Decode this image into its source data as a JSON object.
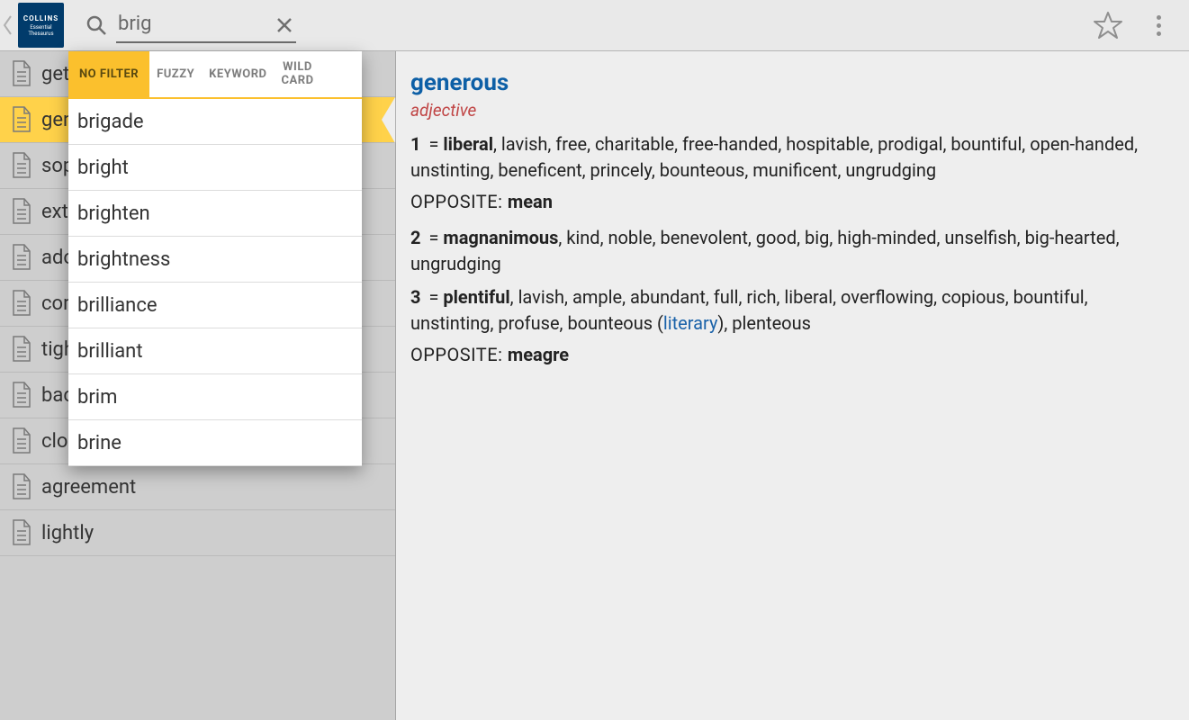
{
  "logo": {
    "line1": "COLLINS",
    "line2": "Essential",
    "line3": "Thesaurus"
  },
  "search": {
    "query": "brig"
  },
  "filters": {
    "nofilter": "NO FILTER",
    "fuzzy": "FUZZY",
    "keyword": "KEYWORD",
    "wild1": "WILD",
    "wild2": "CARD"
  },
  "suggestions": {
    "i0": "brigade",
    "i1": "bright",
    "i2": "brighten",
    "i3": "brightness",
    "i4": "brilliance",
    "i5": "brilliant",
    "i6": "brim",
    "i7": "brine"
  },
  "history": {
    "i0": "get",
    "i1": "generous",
    "i2": "sophisticated",
    "i3": "extreme",
    "i4": "adorn",
    "i5": "compromise",
    "i6": "tight",
    "i7": "background",
    "i8": "close",
    "i9": "agreement",
    "i10": "lightly"
  },
  "entry": {
    "word": "generous",
    "pos": "adjective",
    "s1": {
      "num": "1",
      "eq": " = ",
      "head": "liberal",
      "rest": ", lavish, free, charitable, free-handed, hospitable, prodigal, bountiful, open-handed, unstinting, beneficent, princely, bounteous, munificent, ungrudging"
    },
    "op1": {
      "label": "OPPOSITE: ",
      "word": "mean"
    },
    "s2": {
      "num": "2",
      "eq": " = ",
      "head": "magnanimous",
      "rest": ", kind, noble, benevolent, good, big, high-minded, unselfish, big-hearted, ungrudging"
    },
    "s3": {
      "num": "3",
      "eq": " = ",
      "head": "plentiful",
      "rest1": ", lavish, ample, abundant, full, rich, liberal, overflowing, copious, bountiful, unstinting, profuse, bounteous (",
      "lit": "literary",
      "rest2": "), plenteous"
    },
    "op3": {
      "label": "OPPOSITE: ",
      "word": "meagre"
    }
  }
}
